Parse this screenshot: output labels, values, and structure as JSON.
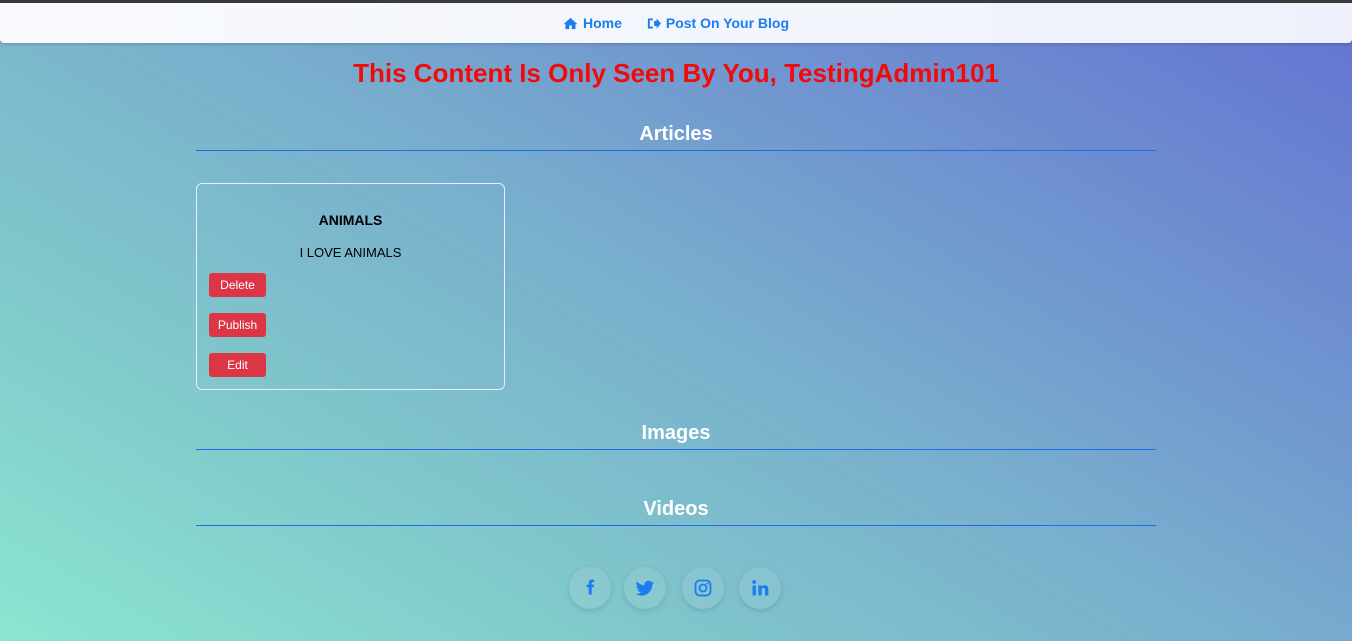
{
  "nav": {
    "home_label": "Home",
    "post_label": "Post On Your Blog",
    "home_icon": "home-icon",
    "post_icon": "sign-out-icon"
  },
  "headline": "This Content Is Only Seen By You, TestingAdmin101",
  "sections": {
    "articles": "Articles",
    "images": "Images",
    "videos": "Videos"
  },
  "article_card": {
    "title": "ANIMALS",
    "body": "I LOVE ANIMALS",
    "delete_label": "Delete",
    "publish_label": "Publish",
    "edit_label": "Edit"
  },
  "social": {
    "icons": [
      "facebook-icon",
      "twitter-icon",
      "instagram-icon",
      "linkedin-icon"
    ]
  },
  "colors": {
    "accent": "#1a7ef0",
    "headline": "#f20a0a",
    "button": "#dc3545",
    "divider": "#1e6bf0"
  }
}
